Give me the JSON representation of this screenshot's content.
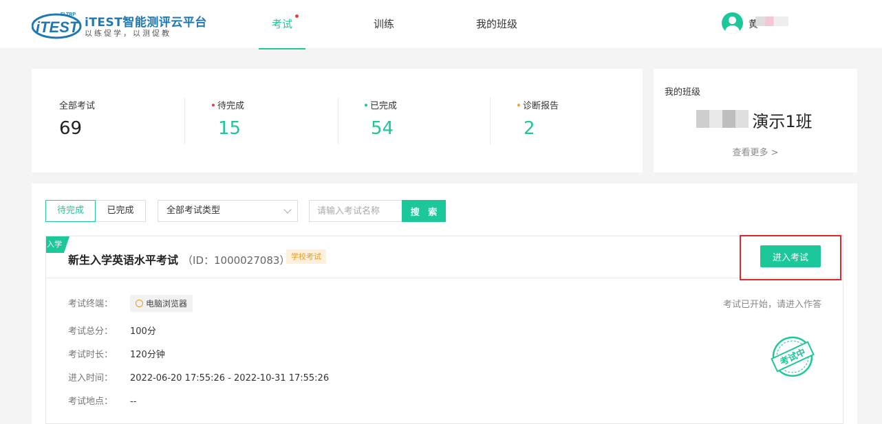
{
  "header": {
    "logo": {
      "brand": "iTEST",
      "tag": "FLTRP",
      "title": "iTEST智能测评云平台",
      "slogan": "以练促学，以测促教"
    },
    "nav": [
      {
        "label": "考试",
        "active": true,
        "badge": true
      },
      {
        "label": "训练",
        "active": false
      },
      {
        "label": "我的班级",
        "active": false
      }
    ],
    "user": {
      "name": "黄"
    }
  },
  "stats": {
    "items": [
      {
        "label": "全部考试",
        "value": "69"
      },
      {
        "label": "待完成",
        "value": "15",
        "dot_color": "#ee3b3b"
      },
      {
        "label": "已完成",
        "value": "54",
        "dot_color": "#1cc79a"
      },
      {
        "label": "诊断报告",
        "value": "2",
        "dot_color": "#f5a623"
      }
    ]
  },
  "my_class": {
    "heading": "我的班级",
    "name": "演示1班",
    "more": "查看更多 >"
  },
  "filters": {
    "tabs": [
      {
        "label": "待完成",
        "active": true
      },
      {
        "label": "已完成",
        "active": false
      }
    ],
    "type_select": "全部考试类型",
    "search_placeholder": "请输入考试名称",
    "search_button": "搜 索"
  },
  "exam": {
    "ribbon": "入学",
    "title": "新生入学英语水平考试",
    "id_text": "（ID：1000027083）",
    "tag": "学校考试",
    "enter_button": "进入考试",
    "status": "考试已开始，请进入作答",
    "stamp": "考试中",
    "details": {
      "device_label": "考试终端：",
      "device_value": "电脑浏览器",
      "score_label": "考试总分：",
      "score_value": "100分",
      "duration_label": "考试时长：",
      "duration_value": "120分钟",
      "time_label": "进入时间：",
      "time_value": "2022-06-20 17:55:26 - 2022-10-31 17:55:26",
      "location_label": "考试地点：",
      "location_value": "--"
    }
  },
  "colors": {
    "accent": "#1cc79a",
    "highlight_box": "#e0262b",
    "brand_blue": "#1e78b4"
  }
}
